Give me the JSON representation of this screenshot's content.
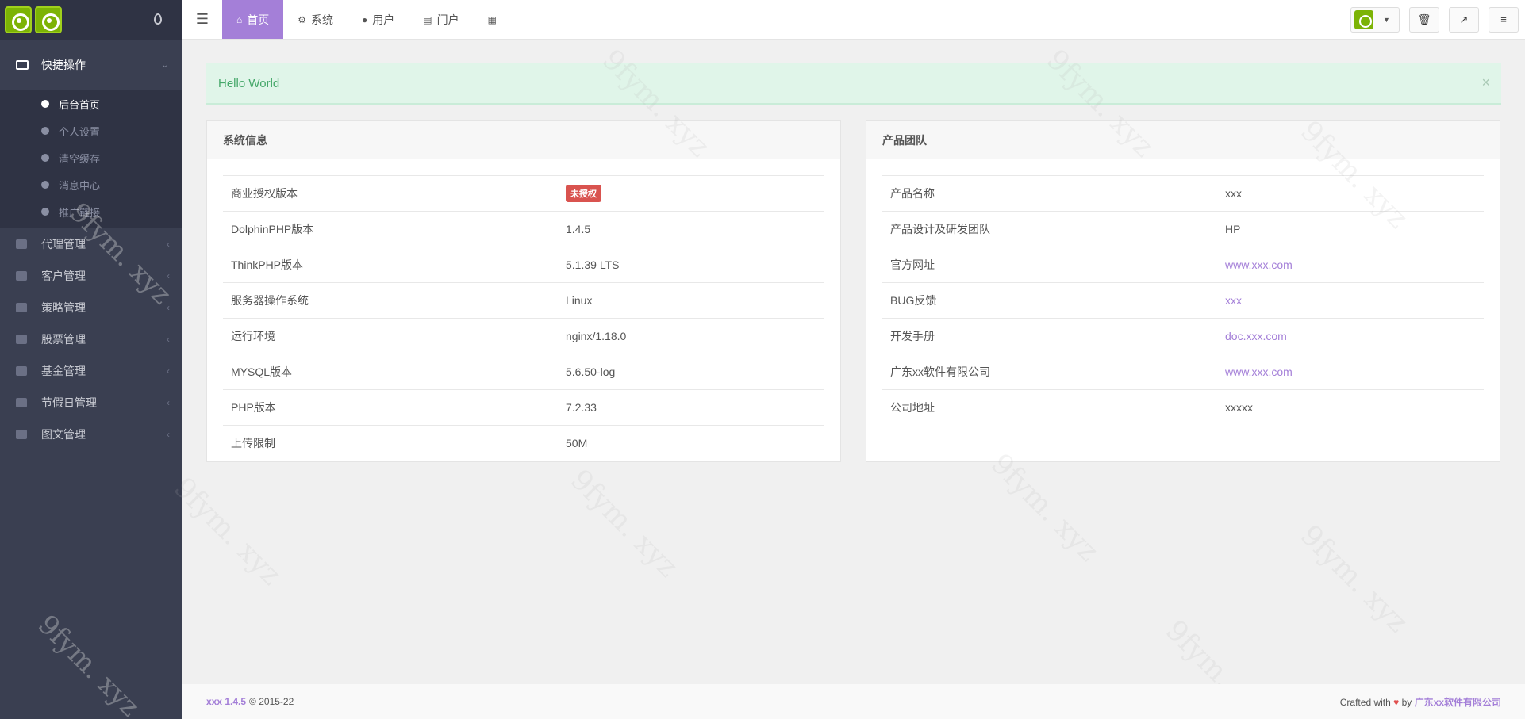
{
  "sidebar": {
    "groups": [
      {
        "label": "快捷操作",
        "items": [
          {
            "label": "后台首页",
            "icon": "dashboard-icon"
          },
          {
            "label": "个人设置",
            "icon": "user-icon"
          },
          {
            "label": "清空缓存",
            "icon": "trash-icon"
          },
          {
            "label": "消息中心",
            "icon": "comments-icon"
          },
          {
            "label": "推广链接",
            "icon": "share-icon"
          }
        ]
      }
    ],
    "menu": [
      {
        "label": "代理管理",
        "icon": "users-icon"
      },
      {
        "label": "客户管理",
        "icon": "user-icon"
      },
      {
        "label": "策略管理",
        "icon": "list-icon"
      },
      {
        "label": "股票管理",
        "icon": "gears-icon"
      },
      {
        "label": "基金管理",
        "icon": "coins-icon"
      },
      {
        "label": "节假日管理",
        "icon": "calendar-icon"
      },
      {
        "label": "图文管理",
        "icon": "book-icon"
      }
    ]
  },
  "header": {
    "tabs": [
      {
        "label": "首页",
        "icon": "home-icon"
      },
      {
        "label": "系统",
        "icon": "gear-icon"
      },
      {
        "label": "用户",
        "icon": "user-icon"
      },
      {
        "label": "门户",
        "icon": "newspaper-icon"
      },
      {
        "label": "",
        "icon": "grid-icon"
      }
    ]
  },
  "alert": {
    "text": "Hello World"
  },
  "system_info": {
    "title": "系统信息",
    "rows": [
      {
        "key": "商业授权版本",
        "value": "未授权",
        "badge": true
      },
      {
        "key": "DolphinPHP版本",
        "value": "1.4.5"
      },
      {
        "key": "ThinkPHP版本",
        "value": "5.1.39 LTS"
      },
      {
        "key": "服务器操作系统",
        "value": "Linux"
      },
      {
        "key": "运行环境",
        "value": "nginx/1.18.0"
      },
      {
        "key": "MYSQL版本",
        "value": "5.6.50-log"
      },
      {
        "key": "PHP版本",
        "value": "7.2.33"
      },
      {
        "key": "上传限制",
        "value": "50M"
      }
    ]
  },
  "product_team": {
    "title": "产品团队",
    "rows": [
      {
        "key": "产品名称",
        "value": "xxx"
      },
      {
        "key": "产品设计及研发团队",
        "value": "HP"
      },
      {
        "key": "官方网址",
        "value": "www.xxx.com",
        "link": true
      },
      {
        "key": "BUG反馈",
        "value": "xxx",
        "link": true
      },
      {
        "key": "开发手册",
        "value": "doc.xxx.com",
        "link": true
      },
      {
        "key": "广东xx软件有限公司",
        "value": "www.xxx.com",
        "link": true
      },
      {
        "key": "公司地址",
        "value": "xxxxx"
      }
    ]
  },
  "footer": {
    "brand": "xxx 1.4.5",
    "copyright": "© 2015-22",
    "crafted": "Crafted with",
    "by": "by",
    "company": "广东xx软件有限公司"
  },
  "watermark": "9fym. xyz",
  "colors": {
    "accent": "#a47fd8",
    "sidebar": "#3a3f51",
    "alert_bg": "#e0f5e9",
    "danger": "#d9534f"
  }
}
